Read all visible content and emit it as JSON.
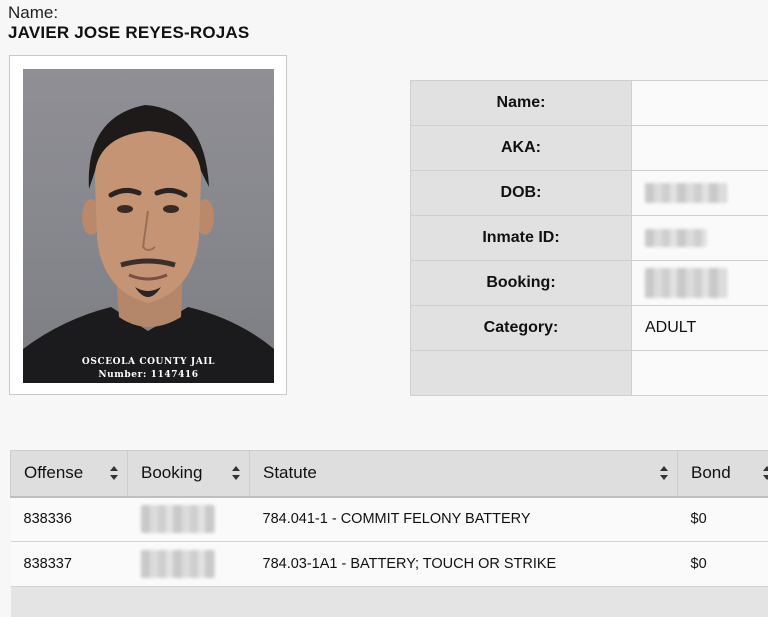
{
  "header": {
    "name_label": "Name:",
    "name_value": "JAVIER JOSE REYES-ROJAS"
  },
  "photo": {
    "jail_name": "OSCEOLA COUNTY JAIL",
    "number_line": "Number: 1147416"
  },
  "details": [
    {
      "label": "Name:",
      "value": ""
    },
    {
      "label": "AKA:",
      "value": ""
    },
    {
      "label": "DOB:",
      "value": ""
    },
    {
      "label": "Inmate ID:",
      "value": ""
    },
    {
      "label": "Booking:",
      "value": ""
    },
    {
      "label": "Category:",
      "value": "ADULT"
    },
    {
      "label": "",
      "value": ""
    }
  ],
  "offenses": {
    "columns": [
      "Offense",
      "Booking",
      "Statute",
      "Bond"
    ],
    "rows": [
      {
        "offense": "838336",
        "booking": "",
        "statute": "784.041-1 - COMMIT FELONY BATTERY",
        "bond": "$0"
      },
      {
        "offense": "838337",
        "booking": "",
        "statute": "784.03-1A1 - BATTERY; TOUCH OR STRIKE",
        "bond": "$0"
      }
    ]
  },
  "icons": {
    "sort": "sort-icon"
  }
}
